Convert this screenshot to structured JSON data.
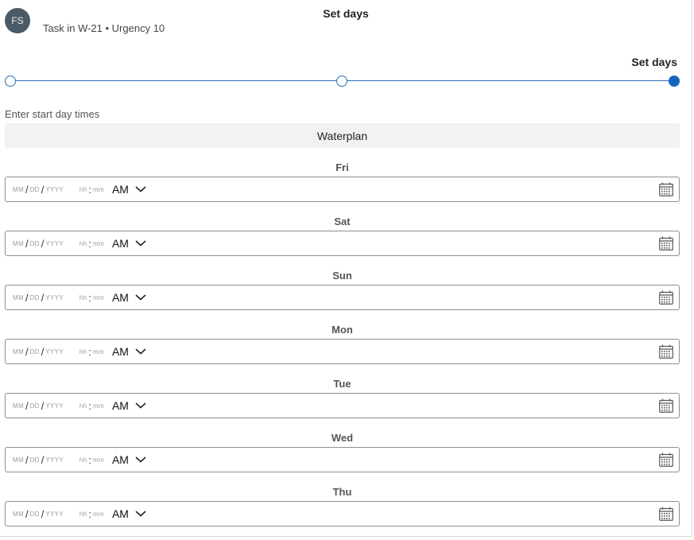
{
  "header": {
    "avatar_initials": "FS",
    "title": "Set days",
    "subtitle": "Task in W-21 • Urgency 10"
  },
  "stepper": {
    "current_step_label": "Set days",
    "steps_total": 3,
    "current_step": 3
  },
  "form": {
    "section_label": "Enter start day times",
    "plan_name": "Waterplan",
    "placeholders": {
      "month": "MM",
      "day": "DD",
      "year": "YYYY",
      "hour": "hh",
      "minute": "mm",
      "date_separator": "/",
      "time_separator": ":"
    },
    "days": [
      {
        "label": "Fri",
        "ampm": "AM"
      },
      {
        "label": "Sat",
        "ampm": "AM"
      },
      {
        "label": "Sun",
        "ampm": "AM"
      },
      {
        "label": "Mon",
        "ampm": "AM"
      },
      {
        "label": "Tue",
        "ampm": "AM"
      },
      {
        "label": "Wed",
        "ampm": "AM"
      },
      {
        "label": "Thu",
        "ampm": "AM"
      }
    ]
  },
  "colors": {
    "accent": "#1566c0",
    "line": "#2b6fb3",
    "avatar_bg": "#4a5a66",
    "plan_bg": "#f2f2f2"
  },
  "icons": {
    "calendar": "calendar-icon",
    "ampm_dropdown": "chevron-down-icon"
  }
}
